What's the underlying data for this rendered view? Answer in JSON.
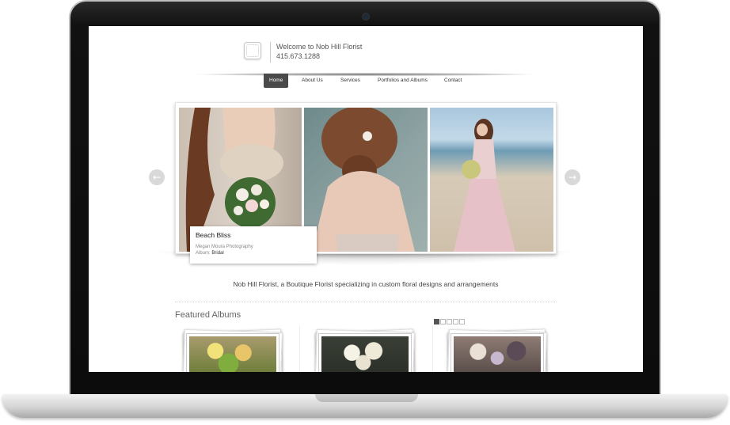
{
  "header": {
    "welcome": "Welcome to Nob Hill Florist",
    "phone": "415.673.1288"
  },
  "nav": {
    "items": [
      {
        "label": "Home",
        "active": true
      },
      {
        "label": "About Us",
        "active": false
      },
      {
        "label": "Services",
        "active": false
      },
      {
        "label": "Portfolios and Albums",
        "active": false
      },
      {
        "label": "Contact",
        "active": false
      }
    ]
  },
  "slider": {
    "prev_icon": "arrow-left-icon",
    "next_icon": "arrow-right-icon",
    "caption": {
      "title": "Beach Bliss",
      "credit": "Megan Moura Photography",
      "album_label": "Album:",
      "album_value": "Bridal"
    },
    "dots": 5,
    "active_dot": 1
  },
  "main": {
    "tagline": "Nob Hill Florist, a Boutique Florist specializing in custom floral designs and arrangements",
    "featured_heading": "Featured Albums"
  },
  "colors": {
    "nav_active_bg": "#4a4a4a",
    "text": "#444444"
  }
}
